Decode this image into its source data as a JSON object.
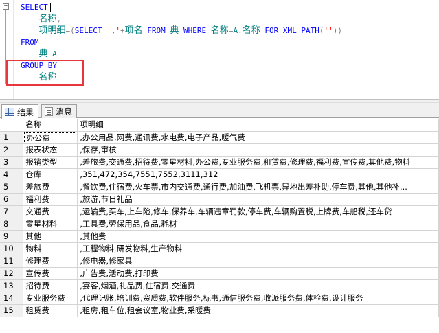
{
  "editor": {
    "lines": [
      {
        "parts": [
          {
            "t": "SELECT",
            "c": "kw"
          }
        ]
      },
      {
        "parts": [
          {
            "t": "    ",
            "c": ""
          },
          {
            "t": "名称",
            "c": "ident zh"
          },
          {
            "t": ",",
            "c": "gr"
          }
        ]
      },
      {
        "parts": [
          {
            "t": "    ",
            "c": ""
          },
          {
            "t": "项明细",
            "c": "ident zh"
          },
          {
            "t": "=(",
            "c": "gr"
          },
          {
            "t": "SELECT",
            "c": "kw"
          },
          {
            "t": " ",
            "c": ""
          },
          {
            "t": "','",
            "c": "st"
          },
          {
            "t": "+",
            "c": "gr"
          },
          {
            "t": "项名",
            "c": "ident zh"
          },
          {
            "t": " ",
            "c": ""
          },
          {
            "t": "FROM",
            "c": "kw"
          },
          {
            "t": " ",
            "c": ""
          },
          {
            "t": "典",
            "c": "ident zh"
          },
          {
            "t": " ",
            "c": ""
          },
          {
            "t": "WHERE",
            "c": "kw"
          },
          {
            "t": " ",
            "c": ""
          },
          {
            "t": "名称",
            "c": "ident zh"
          },
          {
            "t": "=",
            "c": "gr"
          },
          {
            "t": "A",
            "c": "ident"
          },
          {
            "t": ".",
            "c": "gr"
          },
          {
            "t": "名称",
            "c": "ident zh"
          },
          {
            "t": " ",
            "c": ""
          },
          {
            "t": "FOR",
            "c": "kw"
          },
          {
            "t": " ",
            "c": ""
          },
          {
            "t": "XML",
            "c": "kw"
          },
          {
            "t": " ",
            "c": ""
          },
          {
            "t": "PATH",
            "c": "kw"
          },
          {
            "t": "(",
            "c": "gr"
          },
          {
            "t": "''",
            "c": "st"
          },
          {
            "t": "))",
            "c": "gr"
          }
        ]
      },
      {
        "parts": [
          {
            "t": "FROM",
            "c": "kw"
          }
        ]
      },
      {
        "parts": [
          {
            "t": "    ",
            "c": ""
          },
          {
            "t": "典",
            "c": "ident zh"
          },
          {
            "t": " ",
            "c": ""
          },
          {
            "t": "A",
            "c": "ident"
          }
        ]
      },
      {
        "parts": [
          {
            "t": "GROUP BY",
            "c": "kw"
          }
        ]
      },
      {
        "parts": [
          {
            "t": "    ",
            "c": ""
          },
          {
            "t": "名称",
            "c": "ident zh"
          }
        ]
      }
    ]
  },
  "tabs": [
    {
      "label": "结果",
      "icon": "results-grid-icon",
      "active": true
    },
    {
      "label": "消息",
      "icon": "messages-icon",
      "active": false
    }
  ],
  "grid": {
    "columns": [
      "名称",
      "项明细"
    ],
    "rows": [
      [
        "1",
        "办公费",
        ",办公用品,网费,通讯费,水电费,电子产品,暖气费"
      ],
      [
        "2",
        "报表状态",
        ",保存,审核"
      ],
      [
        "3",
        "报销类型",
        ",差旅费,交通费,招待费,零星材料,办公费,专业服务费,租赁费,修理费,福利费,宣传费,其他费,物料"
      ],
      [
        "4",
        "仓库",
        ",351,472,354,7551,7552,3111,312"
      ],
      [
        "5",
        "差旅费",
        ",餐饮费,住宿费,火车票,市内交通费,通行费,加油费,飞机票,异地出差补助,停车费,其他,其他补..."
      ],
      [
        "6",
        "福利费",
        ",旅游,节日礼品"
      ],
      [
        "7",
        "交通费",
        ",运输费,买车,上车险,修车,保养车,车辆违章罚款,停车费,车辆购置税,上牌费,车船税,还车贷"
      ],
      [
        "8",
        "零星材料",
        ",工具费,劳保用品,食品,耗材"
      ],
      [
        "9",
        "其他",
        ",其他费"
      ],
      [
        "10",
        "物料",
        ",工程物料,研发物料,生产物料"
      ],
      [
        "11",
        "修理费",
        ",修电器,修家具"
      ],
      [
        "12",
        "宣传费",
        ",广告费,活动费,打印费"
      ],
      [
        "13",
        "招待费",
        ",宴客,烟酒,礼品费,住宿费,交通费"
      ],
      [
        "14",
        "专业服务费",
        ",代理记账,培训费,资质费,软件服务,标书,通信服务费,收派服务费,体检费,设计服务"
      ],
      [
        "15",
        "租赁费",
        ",租房,租车位,租会议室,物业费,采暖费"
      ]
    ]
  }
}
